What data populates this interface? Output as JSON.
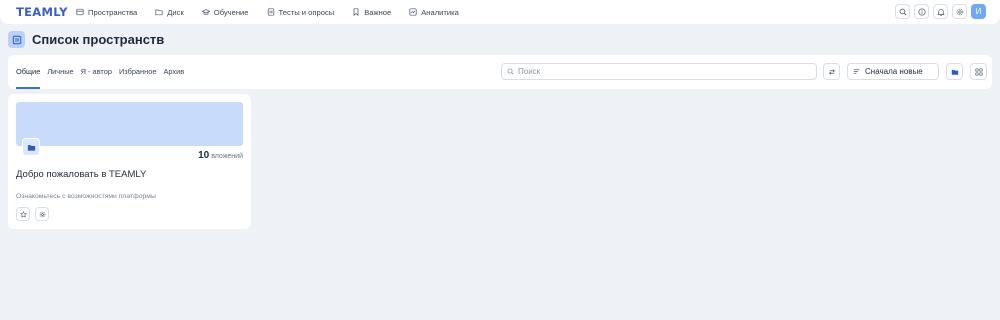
{
  "app": {
    "logo": "TEAMLY"
  },
  "nav": [
    {
      "label": "Пространства",
      "icon": "spaces-icon"
    },
    {
      "label": "Диск",
      "icon": "folder-icon"
    },
    {
      "label": "Обучение",
      "icon": "graduation-icon"
    },
    {
      "label": "Тесты и опросы",
      "icon": "checklist-icon"
    },
    {
      "label": "Важное",
      "icon": "bookmark-icon"
    },
    {
      "label": "Аналитика",
      "icon": "analytics-icon"
    }
  ],
  "top_actions": {
    "icons": [
      "search-icon",
      "info-icon",
      "bell-icon",
      "settings-icon"
    ],
    "avatar_letter": "И"
  },
  "page": {
    "title": "Список пространств",
    "icon": "spaces-list-icon"
  },
  "tabs": [
    {
      "label": "Общие",
      "active": true
    },
    {
      "label": "Личные",
      "active": false
    },
    {
      "label": "Я - автор",
      "active": false
    },
    {
      "label": "Избранное",
      "active": false
    },
    {
      "label": "Архив",
      "active": false
    }
  ],
  "search": {
    "placeholder": "Поиск",
    "value": ""
  },
  "sort": {
    "label": "Сначала новые"
  },
  "spaces": [
    {
      "title": "Добро пожаловать в TEAMLY",
      "description": "Ознакомьтесь с возможностями платформы",
      "count": "10",
      "count_label": "вложений"
    }
  ],
  "colors": {
    "accent": "#3b6fd4",
    "cover": "#c8dbfb",
    "background": "#eef1f6",
    "avatar": "#6fa9f3"
  }
}
